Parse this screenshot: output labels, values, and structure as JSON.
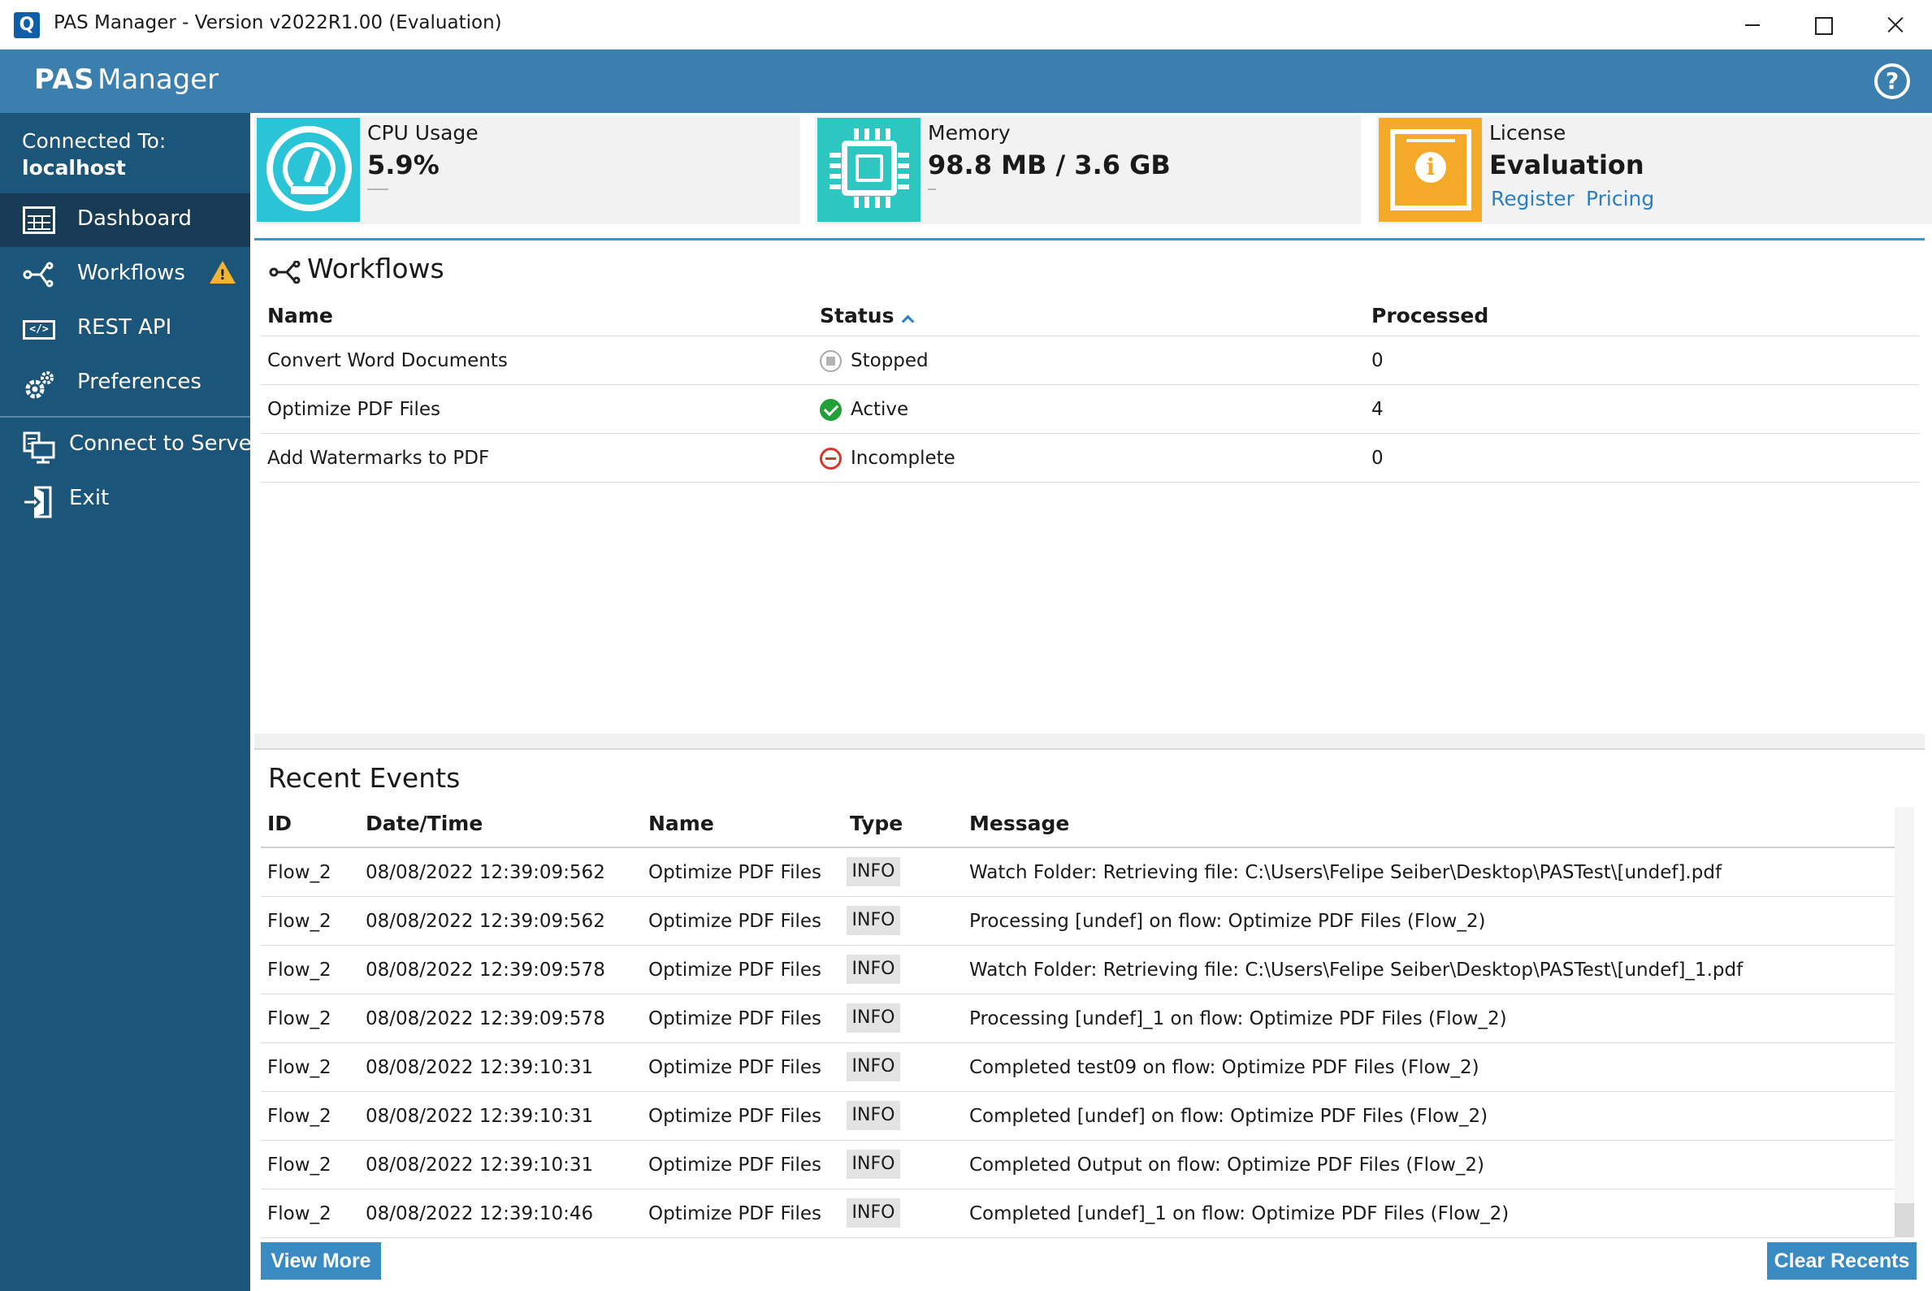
{
  "window": {
    "title": "PAS Manager - Version v2022R1.00 (Evaluation)",
    "app_icon_letter": "Q"
  },
  "header": {
    "brand_bold": "PAS",
    "brand_rest": "Manager",
    "help_glyph": "?"
  },
  "sidebar": {
    "connected_label": "Connected To:",
    "connected_host": "localhost",
    "items": [
      {
        "label": "Dashboard",
        "icon": "dashboard-icon",
        "active": true
      },
      {
        "label": "Workflows",
        "icon": "workflow-icon",
        "warning": true
      },
      {
        "label": "REST API",
        "icon": "code-icon"
      },
      {
        "label": "Preferences",
        "icon": "gear-icon"
      },
      {
        "label": "Connect to Server",
        "icon": "server-icon"
      },
      {
        "label": "Exit",
        "icon": "exit-icon"
      }
    ]
  },
  "stats": {
    "cpu": {
      "label": "CPU Usage",
      "value": "5.9%",
      "color": "#2bc4d6"
    },
    "memory": {
      "label": "Memory",
      "value": "98.8 MB / 3.6 GB",
      "color": "#2ec6c0"
    },
    "license": {
      "label": "License",
      "value": "Evaluation",
      "color": "#f5a928",
      "register_link": "Register",
      "pricing_link": "Pricing"
    }
  },
  "workflows": {
    "title": "Workflows",
    "columns": {
      "name": "Name",
      "status": "Status",
      "processed": "Processed"
    },
    "rows": [
      {
        "name": "Convert Word Documents",
        "status": "Stopped",
        "processed": "0"
      },
      {
        "name": "Optimize PDF Files",
        "status": "Active",
        "processed": "4"
      },
      {
        "name": "Add Watermarks to PDF",
        "status": "Incomplete",
        "processed": "0"
      }
    ]
  },
  "events": {
    "title": "Recent Events",
    "columns": {
      "id": "ID",
      "datetime": "Date/Time",
      "name": "Name",
      "type": "Type",
      "message": "Message"
    },
    "rows": [
      {
        "id": "Flow_2",
        "datetime": "08/08/2022 12:39:09:562",
        "name": "Optimize PDF Files",
        "type": "INFO",
        "message": "Watch Folder: Retrieving file: C:\\Users\\Felipe Seiber\\Desktop\\PASTest\\[undef].pdf"
      },
      {
        "id": "Flow_2",
        "datetime": "08/08/2022 12:39:09:562",
        "name": "Optimize PDF Files",
        "type": "INFO",
        "message": "Processing [undef] on flow: Optimize PDF Files (Flow_2)"
      },
      {
        "id": "Flow_2",
        "datetime": "08/08/2022 12:39:09:578",
        "name": "Optimize PDF Files",
        "type": "INFO",
        "message": "Watch Folder: Retrieving file: C:\\Users\\Felipe Seiber\\Desktop\\PASTest\\[undef]_1.pdf"
      },
      {
        "id": "Flow_2",
        "datetime": "08/08/2022 12:39:09:578",
        "name": "Optimize PDF Files",
        "type": "INFO",
        "message": "Processing [undef]_1 on flow: Optimize PDF Files (Flow_2)"
      },
      {
        "id": "Flow_2",
        "datetime": "08/08/2022 12:39:10:31",
        "name": "Optimize PDF Files",
        "type": "INFO",
        "message": "Completed test09 on flow: Optimize PDF Files (Flow_2)"
      },
      {
        "id": "Flow_2",
        "datetime": "08/08/2022 12:39:10:31",
        "name": "Optimize PDF Files",
        "type": "INFO",
        "message": "Completed [undef] on flow: Optimize PDF Files (Flow_2)"
      },
      {
        "id": "Flow_2",
        "datetime": "08/08/2022 12:39:10:31",
        "name": "Optimize PDF Files",
        "type": "INFO",
        "message": "Completed Output on flow: Optimize PDF Files (Flow_2)"
      },
      {
        "id": "Flow_2",
        "datetime": "08/08/2022 12:39:10:46",
        "name": "Optimize PDF Files",
        "type": "INFO",
        "message": "Completed [undef]_1 on flow: Optimize PDF Files (Flow_2)"
      }
    ],
    "view_more": "View More",
    "clear_recents": "Clear Recents"
  },
  "colors": {
    "header": "#3a7fae",
    "sidebar": "#1b557a",
    "sidebar_active": "#173a55",
    "accent": "#3a8bc2"
  }
}
